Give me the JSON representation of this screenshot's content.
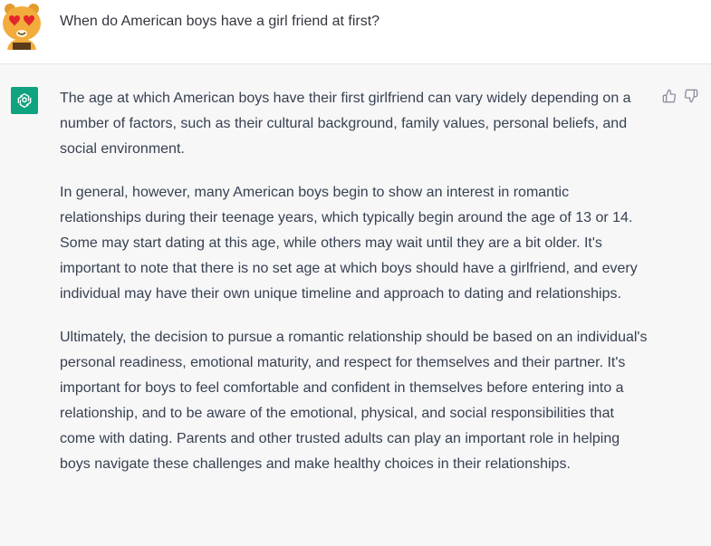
{
  "user": {
    "avatar_icon": "kakao-character-avatar-icon",
    "message": "When do American boys have a girl friend at first?"
  },
  "assistant": {
    "avatar_icon": "chatgpt-logo-icon",
    "avatar_color": "#10a37f",
    "paragraphs": [
      "The age at which American boys have their first girlfriend can vary widely depending on a number of factors, such as their cultural background, family values, personal beliefs, and social environment.",
      "In general, however, many American boys begin to show an interest in romantic relationships during their teenage years, which typically begin around the age of 13 or 14. Some may start dating at this age, while others may wait until they are a bit older. It's important to note that there is no set age at which boys should have a girlfriend, and every individual may have their own unique timeline and approach to dating and relationships.",
      "Ultimately, the decision to pursue a romantic relationship should be based on an individual's personal readiness, emotional maturity, and respect for themselves and their partner. It's important for boys to feel comfortable and confident in themselves before entering into a relationship, and to be aware of the emotional, physical, and social responsibilities that come with dating. Parents and other trusted adults can play an important role in helping boys navigate these challenges and make healthy choices in their relationships."
    ],
    "feedback": {
      "like_icon": "thumbs-up-icon",
      "dislike_icon": "thumbs-down-icon"
    }
  }
}
